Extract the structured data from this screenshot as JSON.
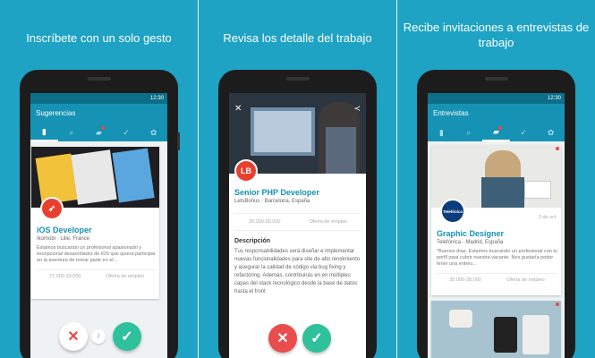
{
  "panels": [
    {
      "caption": "Inscríbete con un solo gesto",
      "status_time": "12:30",
      "appbar_title": "Sugerencias",
      "card": {
        "title": "iOS Developer",
        "company_location": "Ikomobi · Lille, France",
        "description": "Estamos buscando un profesional apasionado y excepcional desarrollador de iOS que quiera participar en la aventura de tomar parte en el...",
        "salary": "27.000-33.000",
        "type": "Oferta de empleo"
      },
      "buttons": {
        "reject": "✕",
        "info": "i",
        "accept": "✓"
      }
    },
    {
      "caption": "Revisa los detalle del trabajo",
      "logo_text": "LB",
      "job_title": "Senior PHP Developer",
      "company_location": "LetsBonus · Barcelona, España",
      "salary": "20.000-30.000",
      "type": "Oferta de empleo",
      "desc_heading": "Descripción",
      "desc_body": "Tus responsabilidades será diseñar e implementar nuevas funcionalidades para site de alto rendimiento y asegurar la calidad de código via bug fixing y refactoring. Además, contribuirás en en múltiples capas del stack tecnológico desde la base de datos hasta el front",
      "buttons": {
        "reject": "✕",
        "accept": "✓"
      }
    },
    {
      "caption": "Recibe invitaciones a entrevistas de trabajo",
      "status_time": "12:30",
      "appbar_title": "Entrevistas",
      "card": {
        "date": "3 de oct.",
        "logo_text": "Telefónica",
        "title": "Graphic Designer",
        "company_location": "Telefónica · Madrid, España",
        "description": "\"Buenos días. Estamos buscando un profesional con tu perfil para cubrir nuestra vacante. Nos gustaría poder tener una entrev...",
        "salary": "35.000-38.000",
        "type": "Oferta de empleo"
      }
    }
  ],
  "colors": {
    "bg": "#1ea3c4",
    "appbar": "#1592b4",
    "accent": "#1592b4",
    "reject": "#ea4d4d",
    "accept": "#2fc19b"
  }
}
